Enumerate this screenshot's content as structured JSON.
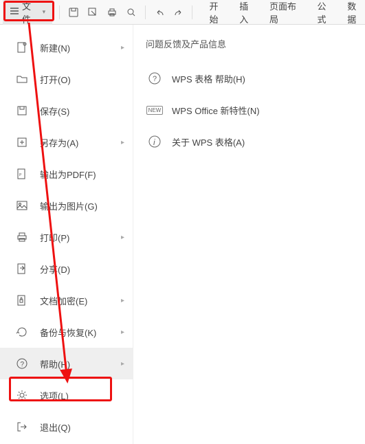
{
  "topbar": {
    "file_label": "文件",
    "tabs": [
      "开始",
      "插入",
      "页面布局",
      "公式",
      "数据"
    ]
  },
  "sidebar": {
    "items": [
      {
        "label": "新建(N)",
        "arrow": true
      },
      {
        "label": "打开(O)"
      },
      {
        "label": "保存(S)"
      },
      {
        "label": "另存为(A)",
        "arrow": true
      },
      {
        "label": "输出为PDF(F)"
      },
      {
        "label": "输出为图片(G)"
      },
      {
        "label": "打印(P)",
        "arrow": true
      },
      {
        "label": "分享(D)"
      },
      {
        "label": "文档加密(E)",
        "arrow": true
      },
      {
        "label": "备份与恢复(K)",
        "arrow": true
      },
      {
        "label": "帮助(H)",
        "arrow": true,
        "selected": true
      },
      {
        "label": "选项(L)"
      },
      {
        "label": "退出(Q)"
      }
    ]
  },
  "panel": {
    "title": "问题反馈及产品信息",
    "items": [
      {
        "label": "WPS 表格 帮助(H)"
      },
      {
        "label": "WPS Office 新特性(N)"
      },
      {
        "label": "关于 WPS 表格(A)"
      }
    ],
    "new_badge": "NEW"
  }
}
